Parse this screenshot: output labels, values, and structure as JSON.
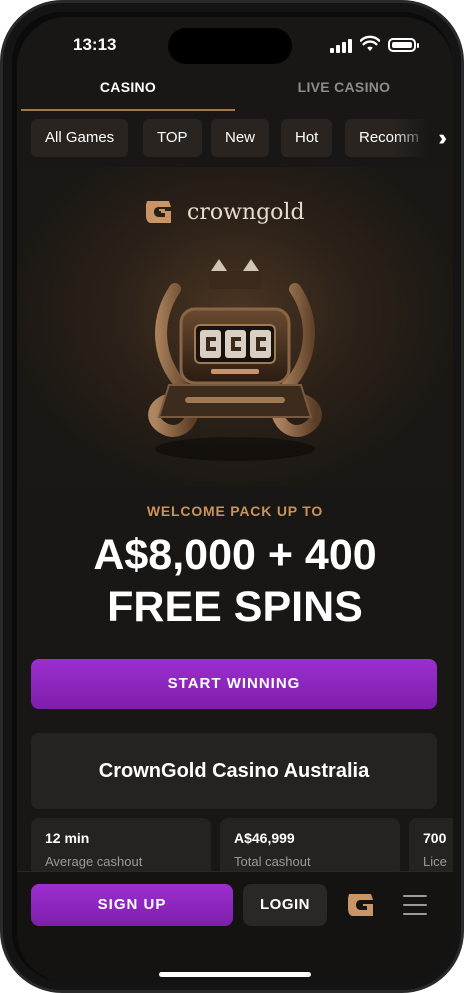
{
  "status_bar": {
    "time": "13:13"
  },
  "tabs": [
    {
      "label": "CASINO",
      "active": true
    },
    {
      "label": "LIVE CASINO",
      "active": false
    }
  ],
  "filters": [
    "All Games",
    "TOP",
    "New",
    "Hot",
    "Recomm"
  ],
  "hero": {
    "brand": "crowngold"
  },
  "promo": {
    "eyebrow": "WELCOME PACK UP TO",
    "line1": "A$8,000 + 400",
    "line2": "FREE SPINS",
    "cta_label": "START WINNING"
  },
  "casino_title": "CrownGold Casino Australia",
  "stats": [
    {
      "value": "12 min",
      "label": "Average cashout"
    },
    {
      "value": "A$46,999",
      "label": "Total cashout"
    },
    {
      "value": "700",
      "label": "Lice"
    }
  ],
  "bottom_bar": {
    "signup_label": "SIGN UP",
    "login_label": "LOGIN"
  },
  "colors": {
    "accent_purple": "#8a25bd",
    "gold": "#c9935a",
    "background": "#181716",
    "card": "#252321"
  },
  "icons": [
    "signal-icon",
    "wifi-icon",
    "battery-icon",
    "chevrons-right-icon",
    "crowngold-logo-icon",
    "menu-icon"
  ]
}
